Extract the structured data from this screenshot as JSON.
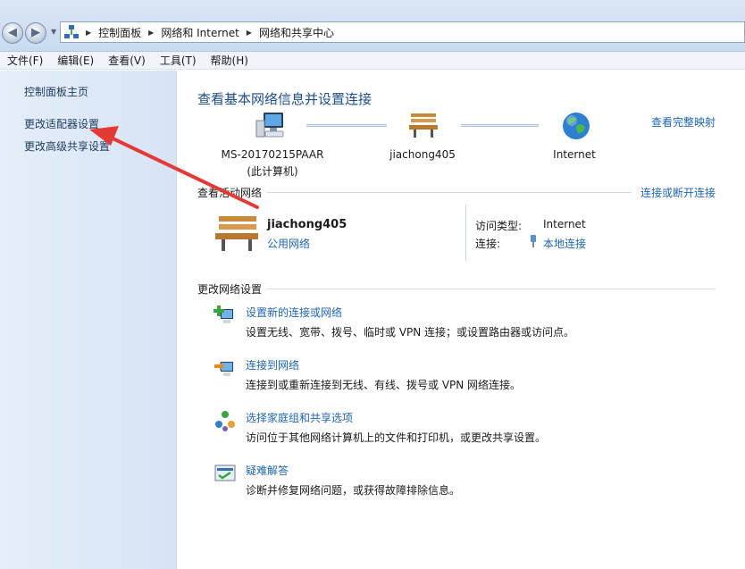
{
  "address_bar": {
    "breadcrumbs": [
      "控制面板",
      "网络和 Internet",
      "网络和共享中心"
    ],
    "back_glyph": "◀",
    "forward_glyph": "▶",
    "dropdown_glyph": "▼",
    "separator_glyph": "▶"
  },
  "menu": [
    "文件(F)",
    "编辑(E)",
    "查看(V)",
    "工具(T)",
    "帮助(H)"
  ],
  "sidebar": {
    "items": [
      {
        "label": "控制面板主页"
      },
      {
        "label": "更改适配器设置"
      },
      {
        "label": "更改高级共享设置"
      }
    ]
  },
  "main": {
    "title": "查看基本网络信息并设置连接",
    "view_full_map": "查看完整映射",
    "map": {
      "computer_name": "MS-20170215PAAR",
      "computer_sub": "(此计算机)",
      "network_name": "jiachong405",
      "internet_label": "Internet"
    },
    "active_networks": {
      "header": "查看活动网络",
      "connect_link": "连接或断开连接",
      "network_name": "jiachong405",
      "network_category": "公用网络",
      "access_type_label": "访问类型:",
      "access_type_value": "Internet",
      "connections_label": "连接:",
      "connections_value": "本地连接"
    },
    "change_settings": {
      "header": "更改网络设置",
      "tasks": [
        {
          "title": "设置新的连接或网络",
          "desc": "设置无线、宽带、拨号、临时或 VPN 连接；或设置路由器或访问点。",
          "icon": "new-connection-icon"
        },
        {
          "title": "连接到网络",
          "desc": "连接到或重新连接到无线、有线、拨号或 VPN 网络连接。",
          "icon": "connect-network-icon"
        },
        {
          "title": "选择家庭组和共享选项",
          "desc": "访问位于其他网络计算机上的文件和打印机，或更改共享设置。",
          "icon": "homegroup-icon"
        },
        {
          "title": "疑难解答",
          "desc": "诊断并修复网络问题，或获得故障排除信息。",
          "icon": "troubleshoot-icon"
        }
      ]
    }
  },
  "colors": {
    "link": "#1e66b0",
    "title": "#1e4e8c",
    "annotation_arrow": "#e53935"
  }
}
